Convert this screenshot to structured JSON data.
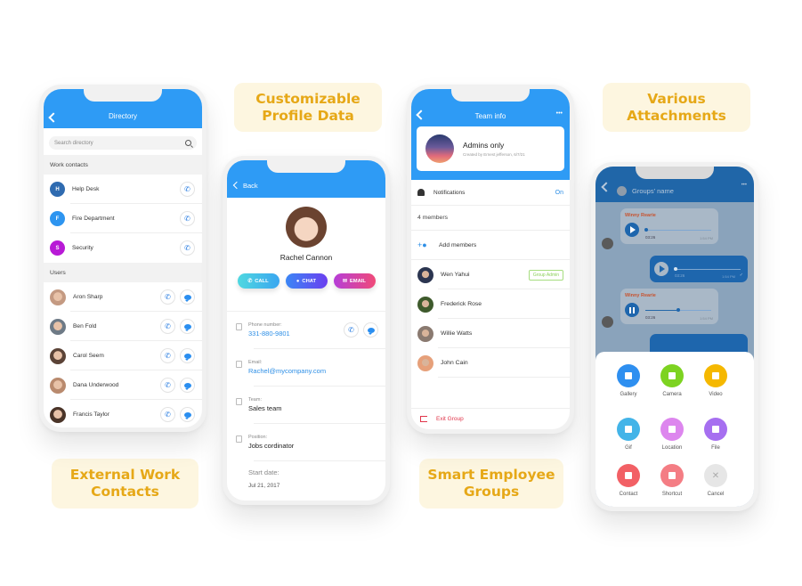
{
  "labels": {
    "customizable": [
      "Customizable",
      "Profile Data"
    ],
    "attachments": [
      "Various",
      "Attachments"
    ],
    "external": [
      "External Work",
      "Contacts"
    ],
    "groups": [
      "Smart Employee",
      "Groups"
    ]
  },
  "directory": {
    "title": "Directory",
    "search_placeholder": "Search directory",
    "work_section": "Work contacts",
    "work_contacts": [
      {
        "initial": "H",
        "name": "Help Desk",
        "color": "#2f6bb0"
      },
      {
        "initial": "F",
        "name": "Fire Department",
        "color": "#2e95f0"
      },
      {
        "initial": "S",
        "name": "Security",
        "color": "#b81ad6"
      }
    ],
    "users_section": "Users",
    "users": [
      {
        "name": "Aron Sharp",
        "color": "#c49a82"
      },
      {
        "name": "Ben Fold",
        "color": "#6e7a86"
      },
      {
        "name": "Carol Seem",
        "color": "#5b4337"
      },
      {
        "name": "Dana Underwood",
        "color": "#b98a6e"
      },
      {
        "name": "Francis Taylor",
        "color": "#4a3428"
      }
    ]
  },
  "profile": {
    "back_label": "Back",
    "name": "Rachel Cannon",
    "actions": [
      {
        "label": "CALL",
        "icon": "phone-icon",
        "gradient": [
          "#4fd8e0",
          "#3aa6f0"
        ]
      },
      {
        "label": "CHAT",
        "icon": "chat-icon",
        "gradient": [
          "#3b86f5",
          "#6b3ff0"
        ]
      },
      {
        "label": "EMAIL",
        "icon": "mail-icon",
        "gradient": [
          "#b63ed8",
          "#f04a78"
        ]
      }
    ],
    "fields": [
      {
        "label": "Phone number:",
        "value": "331-880-9801",
        "link": true,
        "icon": "phone-outline-icon"
      },
      {
        "label": "Email:",
        "value": "Rachel@mycompany.com",
        "link": true,
        "icon": "mail-outline-icon"
      },
      {
        "label": "Team:",
        "value": "Sales team",
        "link": false,
        "icon": "team-icon"
      },
      {
        "label": "Position:",
        "value": "Jobs cordinator",
        "link": false,
        "icon": "building-icon"
      }
    ],
    "start_label": "Start date:",
    "start_value": "Jul 21, 2017"
  },
  "team": {
    "title": "Team info",
    "more": "•••",
    "group_name": "Admins only",
    "group_meta": "Created by Ernest jefferson, 6/7/21",
    "notifications_label": "Notifications",
    "notifications_value": "On",
    "members_count": "4 members",
    "add_members": "Add members",
    "members": [
      {
        "name": "Wen Yahui",
        "badge": "Group Admin",
        "color": "#2b3550"
      },
      {
        "name": "Frederick Rose",
        "badge": "",
        "color": "#3e5a2c"
      },
      {
        "name": "Willie Watts",
        "badge": "",
        "color": "#8a7a70"
      },
      {
        "name": "John Cain",
        "badge": "",
        "color": "#e6a07a"
      }
    ],
    "exit_label": "Exit Group"
  },
  "chat": {
    "title": "Groups' name",
    "more": "•••",
    "messages": [
      {
        "sender": "Winny Rearie",
        "duration": "03:26",
        "time": "1:54 PM",
        "direction": "in",
        "state": "play",
        "progress": 0.0
      },
      {
        "sender": "",
        "duration": "03:26",
        "time": "1:54 PM",
        "direction": "out",
        "state": "play",
        "progress": 0.0,
        "read": "✓"
      },
      {
        "sender": "Winny Rearie",
        "duration": "03:26",
        "time": "1:54 PM",
        "direction": "in",
        "state": "pause",
        "progress": 0.5
      }
    ],
    "attachments": [
      {
        "label": "Gallery",
        "color": "#2e8ff0",
        "icon": "gallery-icon"
      },
      {
        "label": "Camera",
        "color": "#7dd321",
        "icon": "camera-icon"
      },
      {
        "label": "Video",
        "color": "#f5b800",
        "icon": "video-icon"
      },
      {
        "label": "Gif",
        "color": "#43b4e8",
        "icon": "gif-icon"
      },
      {
        "label": "Location",
        "color": "#dd86ee",
        "icon": "location-icon"
      },
      {
        "label": "File",
        "color": "#a66ff0",
        "icon": "file-icon"
      },
      {
        "label": "Contact",
        "color": "#f26065",
        "icon": "contact-icon"
      },
      {
        "label": "Shortcut",
        "color": "#f47d84",
        "icon": "shortcut-icon"
      },
      {
        "label": "Cancel",
        "color": "#e6e6e6",
        "icon": "close-icon"
      }
    ]
  }
}
